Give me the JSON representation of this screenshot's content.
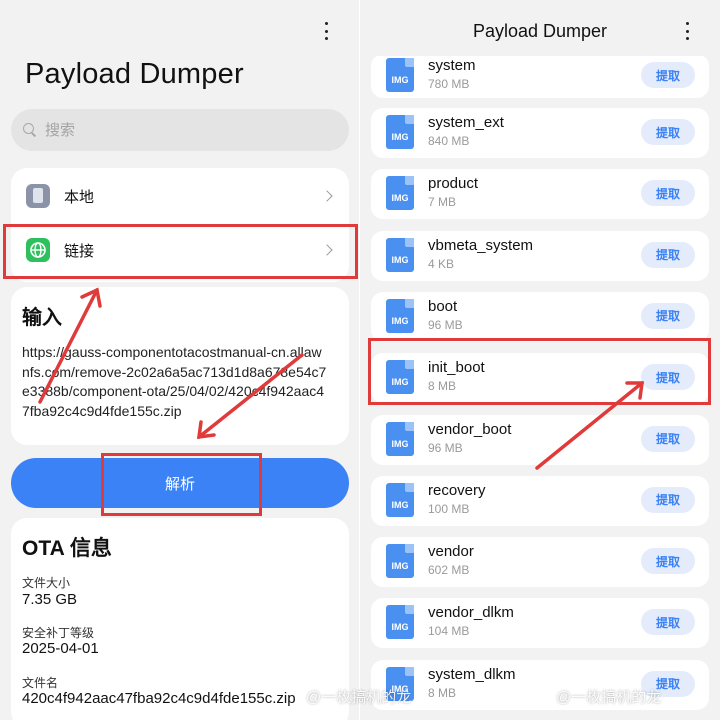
{
  "left": {
    "title": "Payload Dumper",
    "search_placeholder": "搜索",
    "sources": [
      {
        "label": "本地",
        "icon": "phone-icon"
      },
      {
        "label": "链接",
        "icon": "globe-icon"
      }
    ],
    "input": {
      "title": "输入",
      "url": "https://gauss-componentotacostmanual-cn.allawnfs.com/remove-2c02a6a5ac713d1d8a678e54c7e3388b/component-ota/25/04/02/420c4f942aac47fba92c4c9d4fde155c.zip"
    },
    "parse_label": "解析",
    "ota": {
      "title": "OTA 信息",
      "fields": [
        {
          "label": "文件大小",
          "value": "7.35 GB"
        },
        {
          "label": "安全补丁等级",
          "value": "2025-04-01"
        },
        {
          "label": "文件名",
          "value": "420c4f942aac47fba92c4c9d4fde155c.zip"
        }
      ]
    }
  },
  "right": {
    "title": "Payload Dumper",
    "extract_label": "提取",
    "file_icon_text": "IMG",
    "files": [
      {
        "name": "system",
        "size": "780 MB"
      },
      {
        "name": "system_ext",
        "size": "840 MB"
      },
      {
        "name": "product",
        "size": "7 MB"
      },
      {
        "name": "vbmeta_system",
        "size": "4 KB"
      },
      {
        "name": "boot",
        "size": "96 MB"
      },
      {
        "name": "init_boot",
        "size": "8 MB"
      },
      {
        "name": "vendor_boot",
        "size": "96 MB"
      },
      {
        "name": "recovery",
        "size": "100 MB"
      },
      {
        "name": "vendor",
        "size": "602 MB"
      },
      {
        "name": "vendor_dlkm",
        "size": "104 MB"
      },
      {
        "name": "system_dlkm",
        "size": "8 MB"
      }
    ]
  },
  "watermark": "@一枚搞机的龙",
  "colors": {
    "accent": "#3b82f6",
    "annotation": "#e03a3a",
    "background": "#f2f2f2"
  }
}
